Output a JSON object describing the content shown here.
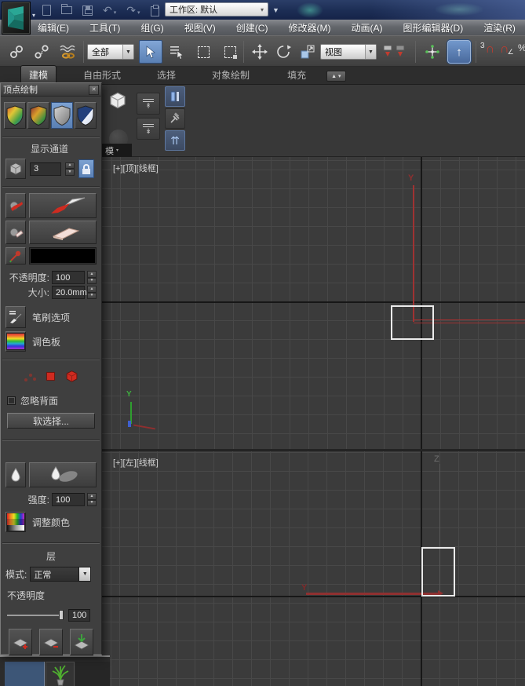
{
  "colors": {
    "selection_blue": "#5d81b8",
    "gizmo_red": "#a03232",
    "axis_green": "#2f9e2f",
    "viewport_bg": "#3b3b3b"
  },
  "icons": {
    "caret_down": "▾",
    "caret_down_small": "▼",
    "spin_up": "▲",
    "spin_down": "▼",
    "undo": "↶",
    "redo": "↷",
    "up_arrow": "↑",
    "magnet": "∩",
    "angle": "∠",
    "percent": "%",
    "close": "✕",
    "ribbon_min_up": "▲",
    "double_up": "⇈"
  },
  "titlebar": {
    "workspace": "工作区: 默认"
  },
  "menubar": {
    "items": [
      "编辑(E)",
      "工具(T)",
      "组(G)",
      "视图(V)",
      "创建(C)",
      "修改器(M)",
      "动画(A)",
      "图形编辑器(D)",
      "渲染(R)"
    ]
  },
  "toolbar": {
    "selection_filter": "全部",
    "coord_system": "视图",
    "snap_count": "3"
  },
  "ribbon": {
    "tabs": [
      "建模",
      "自由形式",
      "选择",
      "对象绘制",
      "填充"
    ],
    "collapsed_label": "模"
  },
  "panel": {
    "title": "顶点绘制",
    "display_channel_label": "显示通道",
    "channel_value": "3",
    "opacity_label": "不透明度:",
    "opacity_value": "100",
    "size_label": "大小:",
    "size_value": "20.0mm",
    "brush_options_label": "笔刷选项",
    "palette_label": "调色板",
    "ignore_backfacing_label": "忽略背面",
    "soft_selection_label": "软选择...",
    "strength_label": "强度:",
    "strength_value": "100",
    "adjust_color_label": "调整颜色",
    "layer_title": "层",
    "mode_label": "模式:",
    "mode_value": "正常",
    "layer_opacity_label": "不透明度",
    "layer_opacity_value": "100"
  },
  "viewports": {
    "top": {
      "label": "[+][顶][线框]",
      "axis_y": "Y"
    },
    "left": {
      "label": "[+][左][线框]",
      "axis_y": "Y",
      "axis_z": "Z"
    }
  }
}
